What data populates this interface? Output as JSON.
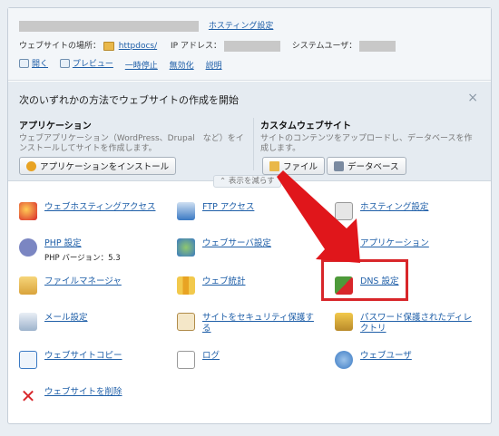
{
  "top": {
    "hosting_settings_link": "ホスティング設定",
    "site_location_label": "ウェブサイトの場所：",
    "site_location_value": "httpdocs/",
    "ip_label": "IP アドレス：",
    "system_user_label": "システムユーザ：",
    "actions": [
      "開く",
      "プレビュー",
      "一時停止",
      "無効化",
      "説明"
    ]
  },
  "create": {
    "title": "次のいずれかの方法でウェブサイトの作成を開始",
    "close": "×",
    "app_heading": "アプリケーション",
    "app_desc_line1": "ウェブアプリケーション（WordPress、Drupal　など）をイ",
    "app_desc_line2": "ンストールしてサイトを作成します。",
    "app_button": "アプリケーションをインストール",
    "custom_heading": "カスタムウェブサイト",
    "custom_desc_line1": "サイトのコンテンツをアップロードし、データベースを作",
    "custom_desc_line2": "成します。",
    "file_button": "ファイル",
    "db_button": "データベース",
    "collapse": "表示を減らす"
  },
  "tools": {
    "web_hosting_access": "ウェブホスティングアクセス",
    "ftp_access": "FTP アクセス",
    "hosting_settings": "ホスティング設定",
    "php_settings": "PHP 設定",
    "php_version": "PHP バージョン：5.3",
    "web_server_settings": "ウェブサーバ設定",
    "applications": "アプリケーション",
    "file_manager": "ファイルマネージャ",
    "web_stats": "ウェブ統計",
    "dns_settings": "DNS 設定",
    "mail_settings": "メール設定",
    "secure_site_1": "サイトをセキュリティ保護す",
    "secure_site_2": "る",
    "password_dirs_1": "パスワード保護されたディレ",
    "password_dirs_2": "クトリ",
    "website_copy": "ウェブサイトコピー",
    "logs": "ログ",
    "web_users": "ウェブユーザ",
    "delete_website": "ウェブサイトを削除"
  },
  "icons": {
    "colors": {
      "blue": "#3a79c3",
      "folder": "#e9b84a",
      "red": "#d8262a",
      "green": "#4d9a3a",
      "arrow": "#e0161b"
    }
  }
}
